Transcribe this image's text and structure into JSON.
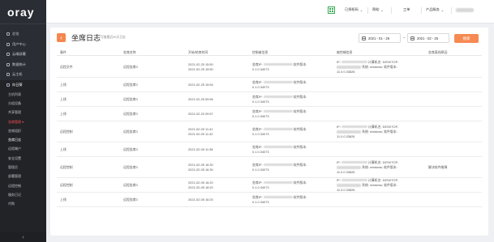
{
  "app": {
    "logo": "oray"
  },
  "sidebar": {
    "items": [
      {
        "label": "总览",
        "icon": "home-icon"
      },
      {
        "label": "用户中心",
        "icon": "user-icon"
      },
      {
        "label": "云端部署",
        "icon": "cloud-icon"
      },
      {
        "label": "数据统计",
        "icon": "chart-icon"
      },
      {
        "label": "云主机",
        "icon": "server-icon"
      },
      {
        "label": "向日葵",
        "icon": "sunflower-icon"
      }
    ],
    "sub_items": [
      "主机列表",
      "分组设备",
      "共享管理",
      "坐席管理 ▾",
      "坐席组织",
      "坐席日志",
      "远程端户",
      "安全设置",
      "管理员",
      "部署管理",
      "远程控制",
      "服务日记",
      "代购"
    ],
    "collapse": "‹"
  },
  "topbar": {
    "items": [
      {
        "label": "已授权码",
        "has_caret": true
      },
      {
        "label": "帮助",
        "has_caret": true
      },
      {
        "label": "工单",
        "has_caret": false
      },
      {
        "label": "产品服务",
        "has_caret": true
      }
    ]
  },
  "page": {
    "title": "坐席日志",
    "subtitle": "可查看近30天日志",
    "date_from": "2021 - 01 - 26",
    "date_to": "2021 - 02 - 25",
    "date_sep": "~",
    "search_label": "搜索"
  },
  "table": {
    "headers": [
      "事件",
      "坐席名称",
      "开始/结束时间",
      "控制者信息",
      "被控端信息",
      "坐席离线原因"
    ],
    "rows": [
      {
        "event": "远程文件",
        "seat": "远程坐席3",
        "time": [
          "2021-02-25 15:50",
          "2021-02-25 15:50"
        ],
        "ctrl": [
          "坐席IP: ",
          " 软件版本:",
          "0.1.0.34073"
        ],
        "target": [
          "IP: ",
          " 计算机名: DESKTOP-",
          " 系统: windows; 软件版本:",
          "11.0.0.33826"
        ],
        "reason": ""
      },
      {
        "event": "上线",
        "seat": "远程坐席3",
        "time": [
          "2021-02-25 15:54",
          ""
        ],
        "ctrl": [
          "坐席IP: ",
          " 软件版本:",
          "0.1.0.34073"
        ],
        "target": [],
        "reason": ""
      },
      {
        "event": "上线",
        "seat": "远程坐席3",
        "time": [
          "2021-02-25 09:56",
          ""
        ],
        "ctrl": [
          "坐席IP: ",
          " 软件版本:",
          "0.1.0.34073"
        ],
        "target": [],
        "reason": ""
      },
      {
        "event": "上线",
        "seat": "远程坐席3",
        "time": [
          "2021-02-20 09:57",
          ""
        ],
        "ctrl": [
          "坐席IP: ",
          " 软件版本:",
          "0.1.0.34073"
        ],
        "target": [],
        "reason": ""
      },
      {
        "event": "远程控制",
        "seat": "远程坐席3",
        "time": [
          "2021-02-09 11:41",
          "2021-02-09 11:42"
        ],
        "ctrl": [
          "坐席IP: ",
          " 软件版本:",
          "0.1.0.34073"
        ],
        "target": [
          "IP: ",
          " 计算机名: DESKTOP-",
          " 系统: windows; 软件版本:",
          "11.0.0.33826"
        ],
        "reason": ""
      },
      {
        "event": "上线",
        "seat": "远程坐席3",
        "time": [
          "2021-02-09 11:38",
          ""
        ],
        "ctrl": [
          "坐席IP: ",
          " 软件版本:",
          "0.1.0.34073"
        ],
        "target": [],
        "reason": ""
      },
      {
        "event": "远程控制",
        "seat": "远程坐席3",
        "time": [
          "2021-02-05 16:30",
          "2021-02-05 16:30"
        ],
        "ctrl": [
          "坐席IP: ",
          " 软件版本:",
          "0.1.0.34073"
        ],
        "target": [
          "IP: ",
          " 计算机名: DESKTOP-",
          " 系统: windows; 软件版本:",
          "11.0.0.33826"
        ],
        "reason": "解决软件故障"
      },
      {
        "event": "远程控制",
        "seat": "远程坐席3",
        "time": [
          "2021-02-05 16:20",
          "2021-02-05 16:20"
        ],
        "ctrl": [
          "坐席IP: ",
          " 软件版本:",
          "0.1.0.34073"
        ],
        "target": [
          "IP: ",
          " 计算机名: DESKTOP-",
          " 系统: windows; 软件版本:",
          "11.0.0.33826"
        ],
        "reason": ""
      },
      {
        "event": "上线",
        "seat": "远程坐席3",
        "time": [
          "2021-02-05 16:20",
          ""
        ],
        "ctrl": [
          "坐席IP: ",
          " 软件版本:",
          "0.1.0.34073"
        ],
        "target": [],
        "reason": ""
      }
    ]
  }
}
